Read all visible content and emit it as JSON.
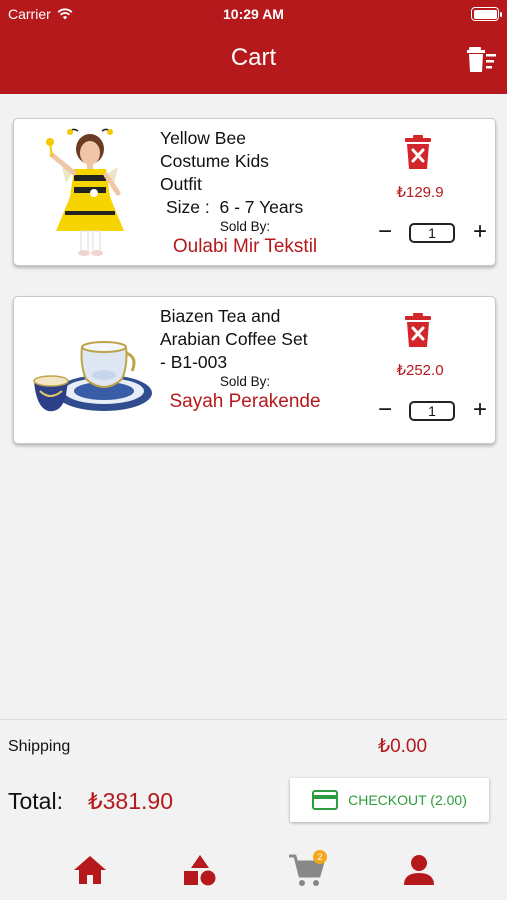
{
  "status_bar": {
    "carrier": "Carrier",
    "time": "10:29 AM"
  },
  "header": {
    "title": "Cart"
  },
  "items": [
    {
      "name_lines": [
        "Yellow Bee",
        "Costume Kids",
        "Outfit"
      ],
      "size_label": "Size :",
      "size_value": "6 - 7 Years",
      "sold_by_label": "Sold By:",
      "seller": "Oulabi Mir Tekstil",
      "price": "₺129.9",
      "quantity": "1"
    },
    {
      "name_lines": [
        "Biazen Tea and",
        "Arabian Coffee Set",
        "- B1-003"
      ],
      "sold_by_label": "Sold By:",
      "seller": "Sayah Perakende",
      "price": "₺252.0",
      "quantity": "1"
    }
  ],
  "summary": {
    "shipping_label": "Shipping",
    "shipping_value": "₺0.00",
    "total_label": "Total:",
    "total_value": "₺381.90",
    "checkout_label": "CHECKOUT (2.00)"
  },
  "tabbar": {
    "cart_badge": "2"
  },
  "colors": {
    "brand_red": "#b5191c",
    "checkout_green": "#2e9c3c",
    "badge_orange": "#f4a71d"
  },
  "icons": [
    "wifi-icon",
    "battery-icon",
    "clear-cart-icon",
    "product-image-bee-costume",
    "product-image-tea-set",
    "trash-icon",
    "home-icon",
    "categories-icon",
    "cart-icon",
    "profile-icon",
    "credit-card-icon"
  ]
}
